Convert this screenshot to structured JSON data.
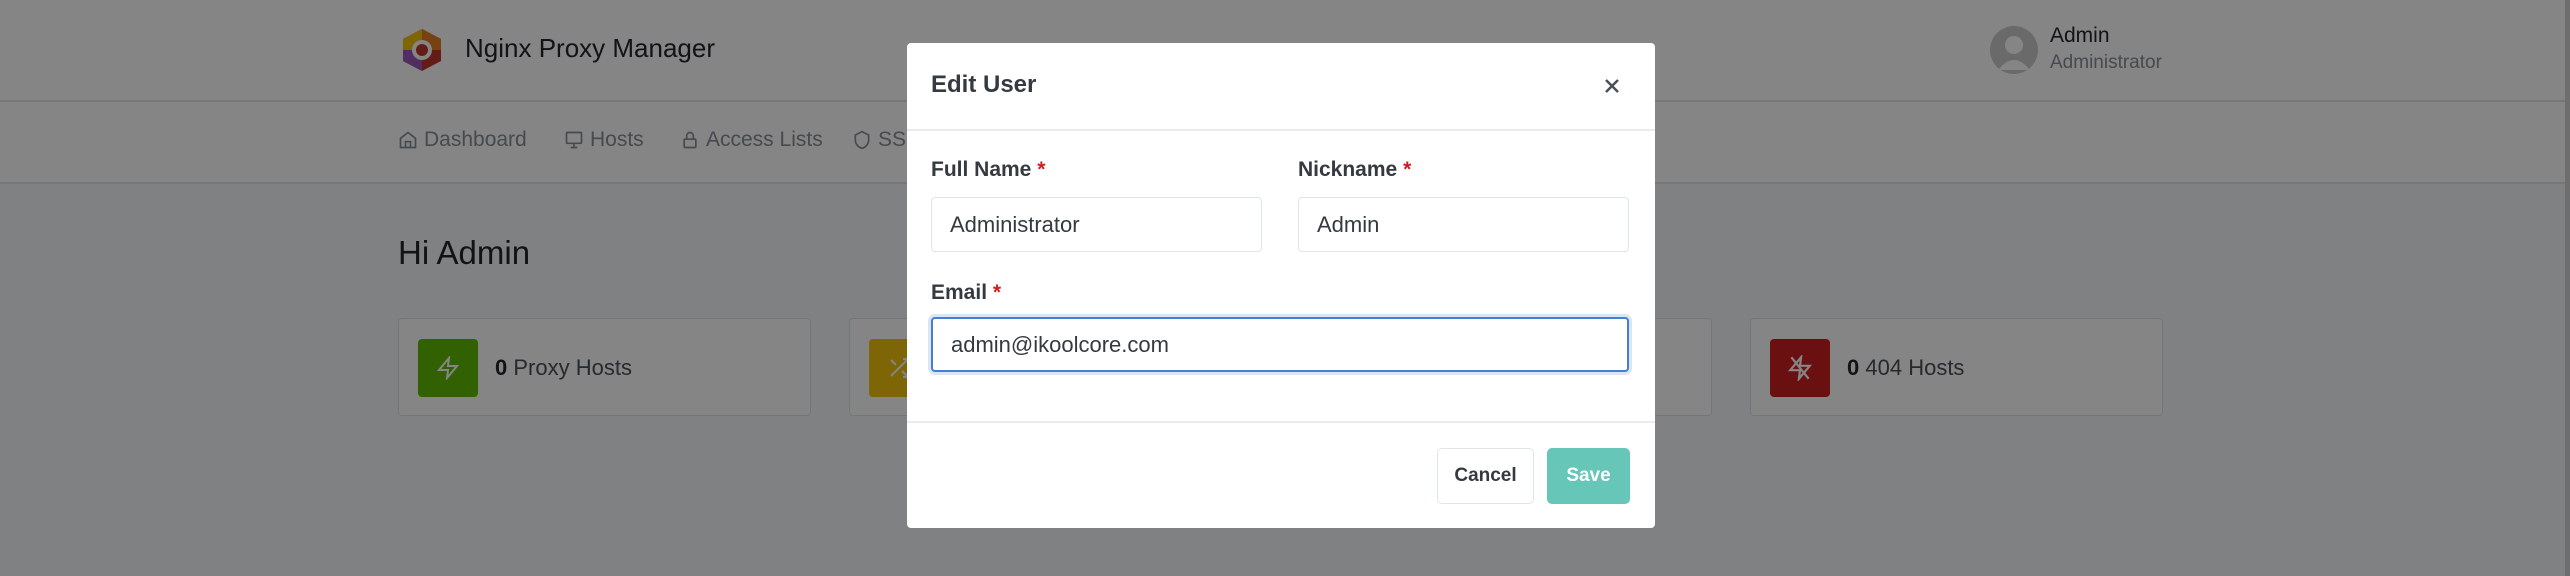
{
  "header": {
    "brand": "Nginx Proxy Manager",
    "user_name": "Admin",
    "user_role": "Administrator"
  },
  "nav": {
    "items": [
      {
        "label": "Dashboard",
        "icon": "home-icon"
      },
      {
        "label": "Hosts",
        "icon": "monitor-icon"
      },
      {
        "label": "Access Lists",
        "icon": "lock-icon"
      },
      {
        "label": "SSL",
        "icon": "shield-icon"
      }
    ]
  },
  "main": {
    "greeting": "Hi Admin",
    "cards": [
      {
        "count": "0",
        "label": "Proxy Hosts",
        "color": "#5eba00",
        "icon": "zap-icon"
      },
      {
        "color": "#f1c40f",
        "icon": "shuffle-icon"
      },
      {
        "color": "#cccccc",
        "icon": "radio-icon"
      },
      {
        "count": "0",
        "label": "404 Hosts",
        "color": "#cd201f",
        "icon": "zap-off-icon"
      }
    ]
  },
  "modal": {
    "title": "Edit User",
    "required_mark": "*",
    "full_name_label": "Full Name",
    "full_name_value": "Administrator",
    "nickname_label": "Nickname",
    "nickname_value": "Admin",
    "email_label": "Email",
    "email_value": "admin@ikoolcore.com",
    "cancel_label": "Cancel",
    "save_label": "Save",
    "save_color": "#66c6b8"
  }
}
